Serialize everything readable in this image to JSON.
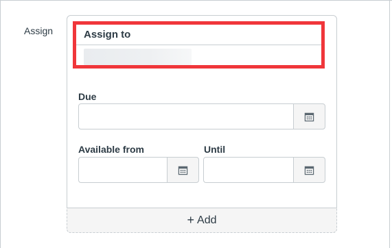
{
  "section": {
    "label": "Assign"
  },
  "assign_to": {
    "label": "Assign to",
    "value": ""
  },
  "due": {
    "label": "Due",
    "value": ""
  },
  "available_from": {
    "label": "Available from",
    "value": ""
  },
  "until": {
    "label": "Until",
    "value": ""
  },
  "footer": {
    "add_icon": "+",
    "add_label": "Add"
  },
  "icons": {
    "calendar": "calendar-icon"
  },
  "colors": {
    "highlight_border": "#f0363a",
    "border": "#c7cdd1",
    "text": "#2d3b45"
  }
}
